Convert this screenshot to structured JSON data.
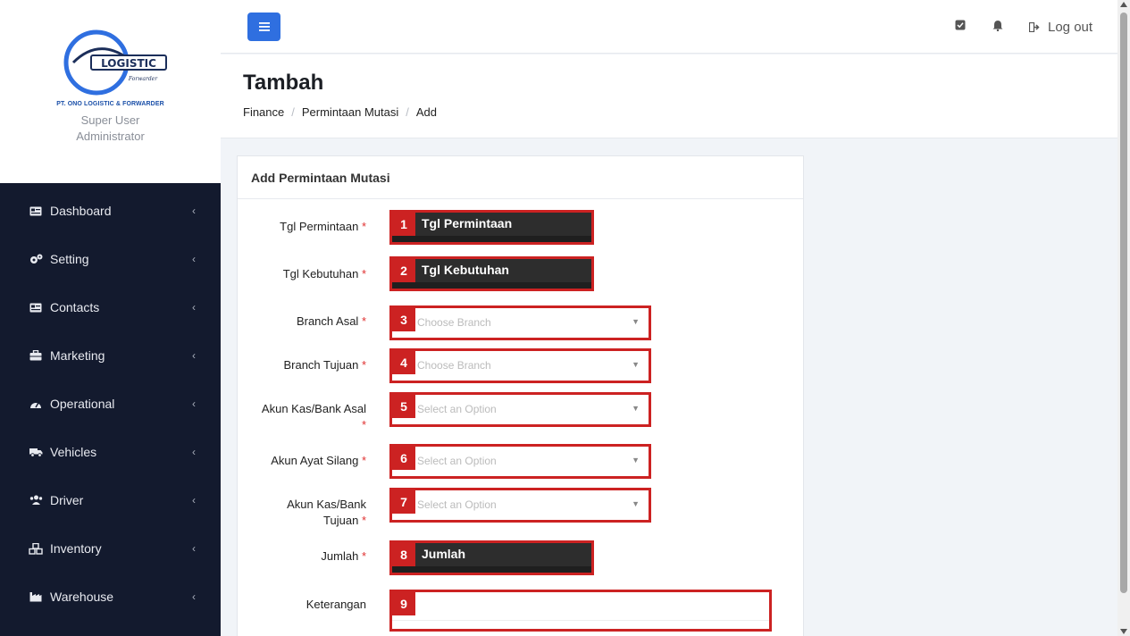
{
  "brand": {
    "logo_word": "LOGISTIC",
    "logo_sub": "Forwarder",
    "company": "PT. ONO LOGISTIC & FORWARDER",
    "role_line1": "Super User",
    "role_line2": "Administrator"
  },
  "menu": [
    {
      "label": "Dashboard",
      "icon": "card-icon"
    },
    {
      "label": "Setting",
      "icon": "gears-icon"
    },
    {
      "label": "Contacts",
      "icon": "address-card-icon"
    },
    {
      "label": "Marketing",
      "icon": "briefcase-icon"
    },
    {
      "label": "Operational",
      "icon": "gauge-icon"
    },
    {
      "label": "Vehicles",
      "icon": "truck-icon"
    },
    {
      "label": "Driver",
      "icon": "users-icon"
    },
    {
      "label": "Inventory",
      "icon": "cubes-icon"
    },
    {
      "label": "Warehouse",
      "icon": "industry-icon"
    }
  ],
  "header": {
    "logout_label": "Log out"
  },
  "page": {
    "title": "Tambah",
    "breadcrumb": [
      "Finance",
      "Permintaan Mutasi",
      "Add"
    ]
  },
  "form": {
    "card_title": "Add Permintaan Mutasi",
    "fields": [
      {
        "label": "Tgl Permintaan",
        "required": "*",
        "badge": "1",
        "text": "Tgl Permintaan"
      },
      {
        "label": "Tgl Kebutuhan",
        "required": "*",
        "badge": "2",
        "text": "Tgl Kebutuhan"
      },
      {
        "label": "Branch Asal",
        "required": "*",
        "badge": "3",
        "placeholder": "Choose Branch"
      },
      {
        "label": "Branch Tujuan",
        "required": "*",
        "badge": "4",
        "placeholder": "Choose Branch"
      },
      {
        "label": "Akun Kas/Bank Asal",
        "required": "*",
        "badge": "5",
        "placeholder": "Select an Option"
      },
      {
        "label": "Akun Ayat Silang",
        "required": "*",
        "badge": "6",
        "placeholder": "Select an Option"
      },
      {
        "label_line1": "Akun Kas/Bank",
        "label_line2": "Tujuan",
        "required": "*",
        "badge": "7",
        "placeholder": "Select an Option"
      },
      {
        "label": "Jumlah",
        "required": "*",
        "badge": "8",
        "text": "Jumlah"
      },
      {
        "label": "Keterangan",
        "badge": "9"
      }
    ]
  },
  "colors": {
    "sidebar_bg": "#131a2e",
    "accent": "#2f6fe0",
    "annotation": "#cc2222"
  }
}
